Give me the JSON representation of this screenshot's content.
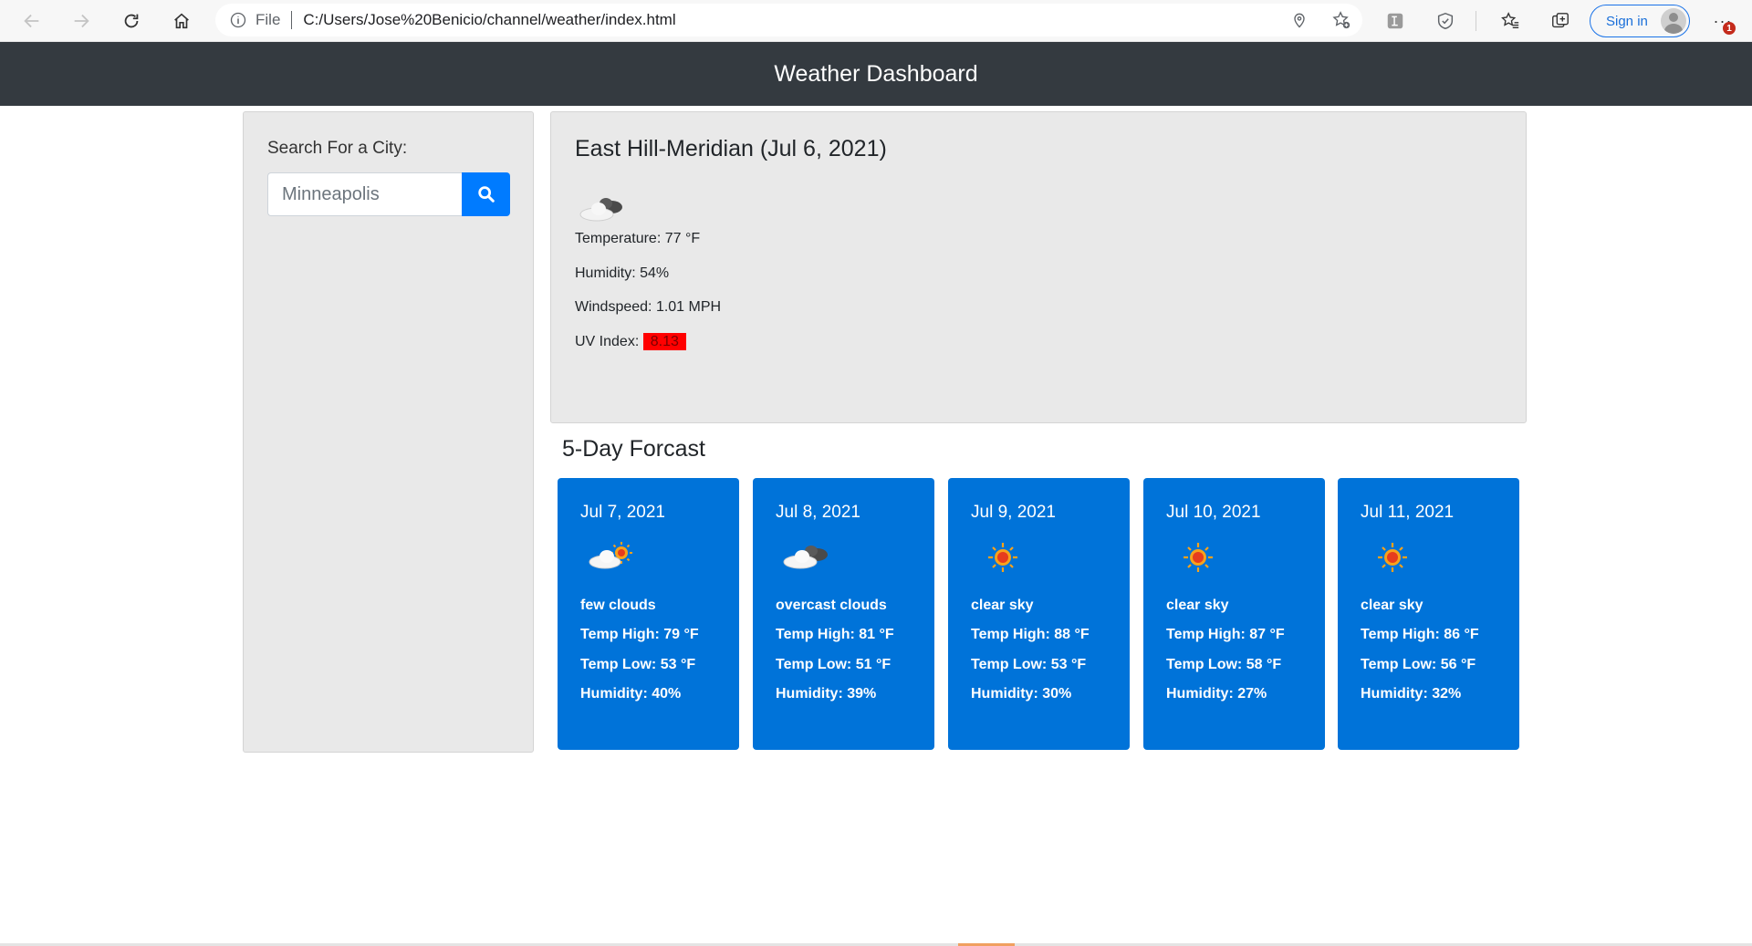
{
  "browser": {
    "address_info": "File",
    "url": "C:/Users/Jose%20Benicio/channel/weather/index.html",
    "sign_in": "Sign in",
    "notification_badge": "1"
  },
  "app": {
    "title": "Weather Dashboard"
  },
  "sidebar": {
    "search_label": "Search For a City:",
    "search_placeholder": "Minneapolis",
    "search_value": "",
    "search_icon": "search-icon",
    "accent_color": "#007bff"
  },
  "current": {
    "title": "East Hill-Meridian (Jul 6, 2021)",
    "icon": "overcast-clouds-icon",
    "temperature": "Temperature: 77 °F",
    "humidity": "Humidity: 54%",
    "windspeed": "Windspeed: 1.01 MPH",
    "uv_label": "UV Index:",
    "uv_value": "8.13",
    "uv_color": "#ff0000"
  },
  "forecast": {
    "title": "5-Day Forcast",
    "card_color": "#0073d9",
    "days": [
      {
        "date": "Jul 7, 2021",
        "icon": "few-clouds-icon",
        "description": "few clouds",
        "high": "Temp High: 79 °F",
        "low": "Temp Low: 53 °F",
        "humidity": "Humidity: 40%"
      },
      {
        "date": "Jul 8, 2021",
        "icon": "overcast-clouds-icon",
        "description": "overcast clouds",
        "high": "Temp High: 81 °F",
        "low": "Temp Low: 51 °F",
        "humidity": "Humidity: 39%"
      },
      {
        "date": "Jul 9, 2021",
        "icon": "clear-sky-icon",
        "description": "clear sky",
        "high": "Temp High: 88 °F",
        "low": "Temp Low: 53 °F",
        "humidity": "Humidity: 30%"
      },
      {
        "date": "Jul 10, 2021",
        "icon": "clear-sky-icon",
        "description": "clear sky",
        "high": "Temp High: 87 °F",
        "low": "Temp Low: 58 °F",
        "humidity": "Humidity: 27%"
      },
      {
        "date": "Jul 11, 2021",
        "icon": "clear-sky-icon",
        "description": "clear sky",
        "high": "Temp High: 86 °F",
        "low": "Temp Low: 56 °F",
        "humidity": "Humidity: 32%"
      }
    ]
  }
}
